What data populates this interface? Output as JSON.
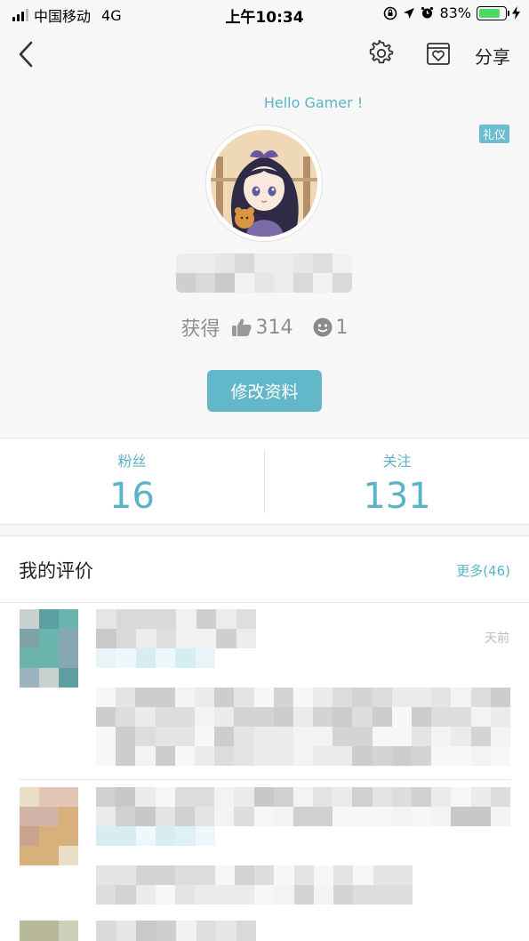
{
  "status_bar": {
    "carrier": "中国移动",
    "network": "4G",
    "time": "上午10:34",
    "battery": "83%",
    "battery_level": 0.83
  },
  "nav": {
    "share_label": "分享"
  },
  "profile": {
    "greeting": "Hello Gamer !",
    "badge": "礼仪",
    "earned_label": "获得",
    "likes": "314",
    "smiles": "1",
    "edit_label": "修改资料"
  },
  "follow": {
    "fans_label": "粉丝",
    "fans_count": "16",
    "following_label": "关注",
    "following_count": "131"
  },
  "reviews": {
    "title": "我的评价",
    "more_label": "更多(46)",
    "items": [
      {
        "time": "天前"
      }
    ]
  },
  "colors": {
    "accent": "#5ab4c6",
    "button": "#62b7c8",
    "battery": "#4cd964"
  }
}
